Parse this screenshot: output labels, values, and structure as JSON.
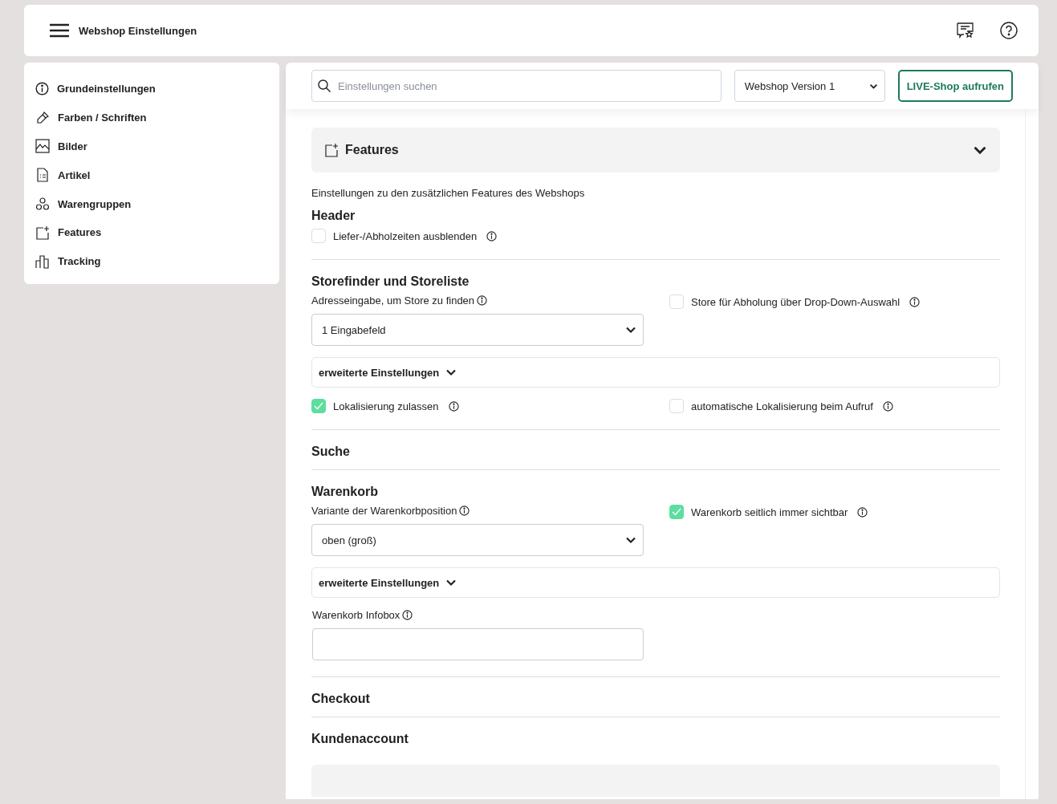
{
  "header": {
    "title": "Webshop Einstellungen"
  },
  "sidebar": {
    "items": [
      {
        "label": "Grundeinstellungen"
      },
      {
        "label": "Farben / Schriften"
      },
      {
        "label": "Bilder"
      },
      {
        "label": "Artikel"
      },
      {
        "label": "Warengruppen"
      },
      {
        "label": "Features"
      },
      {
        "label": "Tracking"
      }
    ]
  },
  "toolbar": {
    "search": {
      "placeholder": "Einstellungen suchen"
    },
    "version_select": {
      "value": "Webshop Version 1"
    },
    "live_button": "LIVE-Shop aufrufen"
  },
  "panel": {
    "title": "Features",
    "description": "Einstellungen zu den zusätzlichen Features des Webshops",
    "sections": [
      {
        "title": "Header",
        "rows": [
          [
            {
              "kind": "checkbox",
              "label": "Liefer-/Abholzeiten ausblenden",
              "checked": false
            }
          ]
        ]
      },
      {
        "title": "Storefinder und Storeliste",
        "rows": [
          [
            {
              "kind": "select",
              "label": "Adresseingabe, um Store zu finden",
              "value": "1 Eingabefeld"
            },
            {
              "kind": "checkbox",
              "label": "Store für Abholung über Drop-Down-Auswahl",
              "checked": false
            }
          ],
          [
            {
              "kind": "advanced",
              "label": "erweiterte Einstellungen"
            }
          ],
          [
            {
              "kind": "checkbox",
              "label": "Lokalisierung zulassen",
              "checked": true
            },
            {
              "kind": "checkbox",
              "label": "automatische Lokalisierung beim Aufruf",
              "checked": false
            }
          ]
        ]
      },
      {
        "title": "Suche"
      },
      {
        "title": "Warenkorb",
        "rows": [
          [
            {
              "kind": "select",
              "label": "Variante der Warenkorbposition",
              "value": "oben (groß)"
            },
            {
              "kind": "checkbox",
              "label": "Warenkorb seitlich immer sichtbar",
              "checked": true
            }
          ],
          [
            {
              "kind": "advanced",
              "label": "erweiterte Einstellungen"
            }
          ],
          [
            {
              "kind": "textarea",
              "label": "Warenkorb Infobox"
            }
          ]
        ]
      },
      {
        "title": "Checkout"
      },
      {
        "title": "Kundenaccount"
      }
    ]
  }
}
